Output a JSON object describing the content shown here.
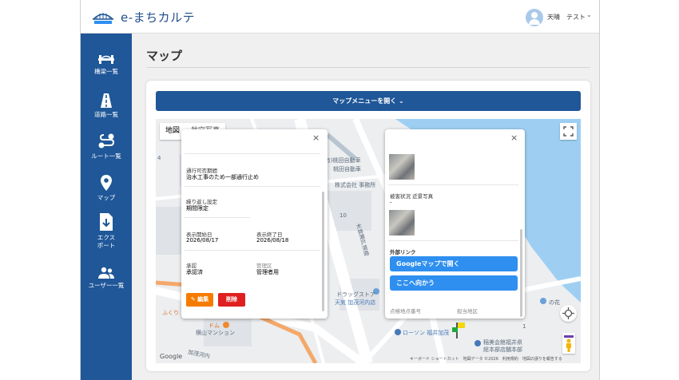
{
  "app": {
    "title": "e-まちカルテ"
  },
  "user": {
    "name": "天晴　テスト"
  },
  "sidebar": {
    "items": [
      {
        "label": "橋梁一覧",
        "icon": "bridge-icon"
      },
      {
        "label": "道路一覧",
        "icon": "road-icon"
      },
      {
        "label": "ルート一覧",
        "icon": "route-icon"
      },
      {
        "label": "マップ",
        "icon": "map-pin-icon"
      },
      {
        "label": "エクス\nポート",
        "icon": "export-icon"
      },
      {
        "label": "ユーザー一覧",
        "icon": "users-icon"
      }
    ]
  },
  "page": {
    "title": "マップ"
  },
  "map_menu": {
    "label": "マップメニューを開く"
  },
  "map": {
    "tabs": [
      {
        "label": "地図",
        "active": true
      },
      {
        "label": "航空写真",
        "active": false
      }
    ],
    "labels": {
      "company1": "(有)桃田自動車",
      "company1b": "桃田自動車",
      "company2": "株式会社 事務所",
      "num10": "10",
      "num4": "4",
      "num1": "1",
      "vertical": "木鉢瀬戸道路",
      "drugstore": "ドラッグストア",
      "drugstore2": "天気 加茂河内店",
      "fukuri": "ふくり",
      "dom": "ドム",
      "mansion": "横山マンション",
      "lawson": "ローソン 福井加茂",
      "town_office": "稲美会館福井県",
      "town_office2": "総本部店舗本部",
      "flower": "の花",
      "street2": "加茂河内"
    },
    "google": "Google",
    "attribution": "キーボード ショートカット　地図データ ©2026　利用規約　地図の誤りを報告する"
  },
  "popup_left": {
    "close": "×",
    "fields": [
      {
        "label": "通行可否期間",
        "value": "治水工事のため一部通行止め"
      },
      {
        "label": "繰り返し設定",
        "value": "期間限定"
      },
      {
        "label": "表示開始日",
        "value": "2026/08/17"
      },
      {
        "label": "表示終了日",
        "value": "2026/08/18"
      },
      {
        "label": "承認",
        "value": "承認済"
      },
      {
        "label": "管理区",
        "value": "管理者用"
      }
    ],
    "edit_label": "編集",
    "delete_label": "削除"
  },
  "popup_right": {
    "close": "×",
    "damage_label": "被害状況 近景写真",
    "damage_value": "-",
    "external_link_label": "外部リンク",
    "google_maps_btn": "Googleマップで開く",
    "directions_btn": "ここへ向かう",
    "footer_left": "点検地点番号",
    "footer_right": "担当地区"
  },
  "colors": {
    "brand": "#1f5798",
    "edit": "#f57c00",
    "delete": "#e02020",
    "link_button": "#2e8ff0"
  }
}
